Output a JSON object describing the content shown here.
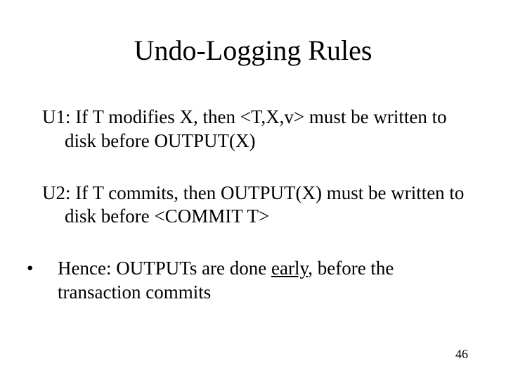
{
  "title": "Undo-Logging Rules",
  "rules": {
    "u1": "U1: If T modifies X, then <T,X,v> must be written to disk before OUTPUT(X)",
    "u2": "U2: If T commits, then OUTPUT(X) must be written to disk before <COMMIT T>"
  },
  "bullet": {
    "pre": "Hence: OUTPUTs are done ",
    "underlined": "early",
    "post": ", before the transaction commits"
  },
  "page_number": "46"
}
